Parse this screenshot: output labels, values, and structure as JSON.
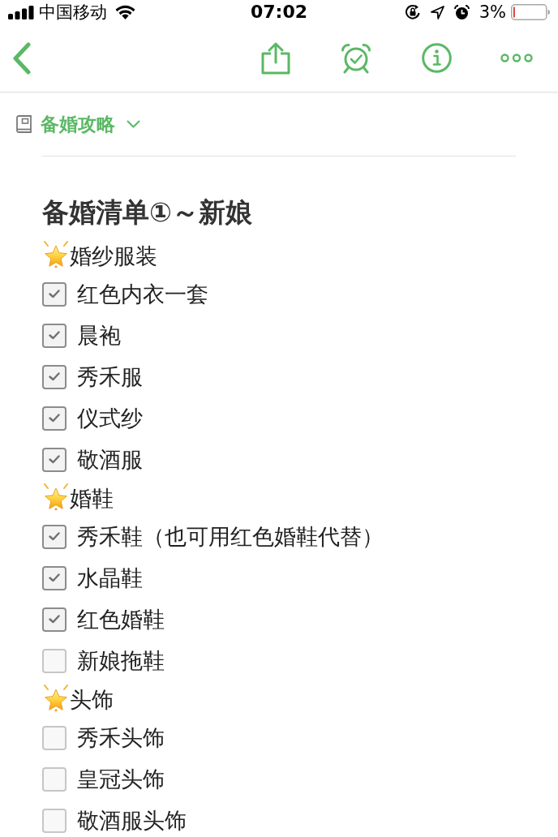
{
  "status_bar": {
    "carrier": "中国移动",
    "time": "07:02",
    "battery": "3%"
  },
  "notebook": {
    "name": "备婚攻略"
  },
  "note": {
    "title": "备婚清单①～新娘",
    "sections": [
      {
        "heading": "婚纱服装",
        "items": [
          {
            "label": "红色内衣一套",
            "checked": true
          },
          {
            "label": "晨袍",
            "checked": true
          },
          {
            "label": "秀禾服",
            "checked": true
          },
          {
            "label": "仪式纱",
            "checked": true
          },
          {
            "label": "敬酒服",
            "checked": true
          }
        ]
      },
      {
        "heading": "婚鞋",
        "items": [
          {
            "label": "秀禾鞋（也可用红色婚鞋代替）",
            "checked": true
          },
          {
            "label": "水晶鞋",
            "checked": true
          },
          {
            "label": "红色婚鞋",
            "checked": true
          },
          {
            "label": "新娘拖鞋",
            "checked": false
          }
        ]
      },
      {
        "heading": "头饰",
        "items": [
          {
            "label": "秀禾头饰",
            "checked": false
          },
          {
            "label": "皇冠头饰",
            "checked": false
          },
          {
            "label": "敬酒服头饰",
            "checked": false
          }
        ]
      }
    ]
  }
}
